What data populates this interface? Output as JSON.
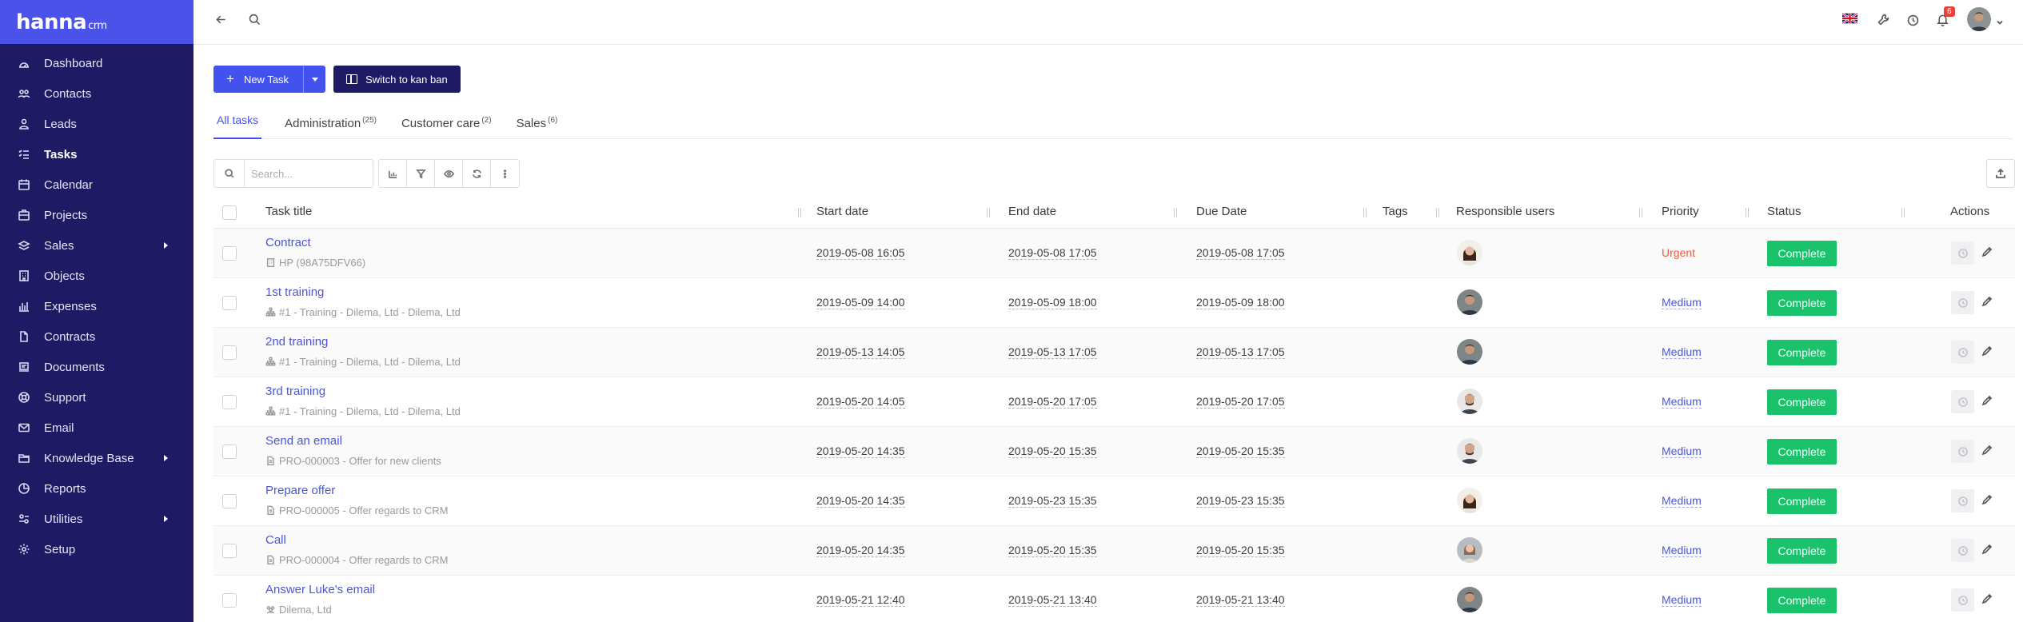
{
  "brand": {
    "name": "hanna",
    "suffix": "crm"
  },
  "sidebar": {
    "items": [
      {
        "label": "Dashboard",
        "icon": "dashboard-icon",
        "arrow": false
      },
      {
        "label": "Contacts",
        "icon": "contacts-icon",
        "arrow": false
      },
      {
        "label": "Leads",
        "icon": "leads-icon",
        "arrow": false
      },
      {
        "label": "Tasks",
        "icon": "tasks-icon",
        "arrow": false,
        "active": true
      },
      {
        "label": "Calendar",
        "icon": "calendar-icon",
        "arrow": false
      },
      {
        "label": "Projects",
        "icon": "projects-icon",
        "arrow": false
      },
      {
        "label": "Sales",
        "icon": "sales-icon",
        "arrow": true
      },
      {
        "label": "Objects",
        "icon": "objects-icon",
        "arrow": false
      },
      {
        "label": "Expenses",
        "icon": "expenses-icon",
        "arrow": false
      },
      {
        "label": "Contracts",
        "icon": "contracts-icon",
        "arrow": false
      },
      {
        "label": "Documents",
        "icon": "documents-icon",
        "arrow": false
      },
      {
        "label": "Support",
        "icon": "support-icon",
        "arrow": false
      },
      {
        "label": "Email",
        "icon": "email-icon",
        "arrow": false
      },
      {
        "label": "Knowledge Base",
        "icon": "knowledge-base-icon",
        "arrow": true
      },
      {
        "label": "Reports",
        "icon": "reports-icon",
        "arrow": false
      },
      {
        "label": "Utilities",
        "icon": "utilities-icon",
        "arrow": true
      },
      {
        "label": "Setup",
        "icon": "setup-icon",
        "arrow": false
      }
    ]
  },
  "topbar": {
    "notifications_count": "6"
  },
  "toolbar": {
    "new_task_label": "New Task",
    "kanban_label": "Switch to kan ban",
    "search_placeholder": "Search..."
  },
  "tabs": [
    {
      "label": "All tasks",
      "count": ""
    },
    {
      "label": "Administration",
      "count": "(25)"
    },
    {
      "label": "Customer care",
      "count": "(2)"
    },
    {
      "label": "Sales",
      "count": "(6)"
    }
  ],
  "columns": {
    "title": "Task title",
    "start": "Start date",
    "end": "End date",
    "due": "Due Date",
    "tags": "Tags",
    "users": "Responsible users",
    "priority": "Priority",
    "status": "Status",
    "actions": "Actions"
  },
  "rows": [
    {
      "title": "Contract",
      "sub": "HP (98A75DFV66)",
      "sub_icon": "building",
      "start": "2019-05-08 16:05",
      "end": "2019-05-08 17:05",
      "due": "2019-05-08 17:05",
      "avatar": "female",
      "priority": "Urgent",
      "priority_kind": "urgent",
      "status": "Complete"
    },
    {
      "title": "1st training",
      "sub": "#1 - Training - Dilema, Ltd - Dilema, Ltd",
      "sub_icon": "org",
      "start": "2019-05-09 14:00",
      "end": "2019-05-09 18:00",
      "due": "2019-05-09 18:00",
      "avatar": "male1",
      "priority": "Medium",
      "priority_kind": "medium",
      "status": "Complete"
    },
    {
      "title": "2nd training",
      "sub": "#1 - Training - Dilema, Ltd - Dilema, Ltd",
      "sub_icon": "org",
      "start": "2019-05-13 14:05",
      "end": "2019-05-13 17:05",
      "due": "2019-05-13 17:05",
      "avatar": "male1",
      "priority": "Medium",
      "priority_kind": "medium",
      "status": "Complete"
    },
    {
      "title": "3rd training",
      "sub": "#1 - Training - Dilema, Ltd - Dilema, Ltd",
      "sub_icon": "org",
      "start": "2019-05-20 14:05",
      "end": "2019-05-20 17:05",
      "due": "2019-05-20 17:05",
      "avatar": "male2",
      "priority": "Medium",
      "priority_kind": "medium",
      "status": "Complete"
    },
    {
      "title": "Send an email",
      "sub": "PRO-000003 - Offer for new clients",
      "sub_icon": "doc",
      "start": "2019-05-20 14:35",
      "end": "2019-05-20 15:35",
      "due": "2019-05-20 15:35",
      "avatar": "male2",
      "priority": "Medium",
      "priority_kind": "medium",
      "status": "Complete"
    },
    {
      "title": "Prepare offer",
      "sub": "PRO-000005 - Offer regards to CRM",
      "sub_icon": "doc",
      "start": "2019-05-20 14:35",
      "end": "2019-05-23 15:35",
      "due": "2019-05-23 15:35",
      "avatar": "female",
      "priority": "Medium",
      "priority_kind": "medium",
      "status": "Complete"
    },
    {
      "title": "Call",
      "sub": "PRO-000004 - Offer regards to CRM",
      "sub_icon": "doc",
      "start": "2019-05-20 14:35",
      "end": "2019-05-20 15:35",
      "due": "2019-05-20 15:35",
      "avatar": "female2",
      "priority": "Medium",
      "priority_kind": "medium",
      "status": "Complete"
    },
    {
      "title": "Answer Luke's email",
      "sub": "Dilema, Ltd",
      "sub_icon": "people",
      "start": "2019-05-21 12:40",
      "end": "2019-05-21 13:40",
      "due": "2019-05-21 13:40",
      "avatar": "male1",
      "priority": "Medium",
      "priority_kind": "medium",
      "status": "Complete"
    }
  ],
  "colors": {
    "sidebar": "#1f1a64",
    "accent": "#4352ec",
    "success": "#19c26b",
    "urgent": "#ef5b3e"
  }
}
